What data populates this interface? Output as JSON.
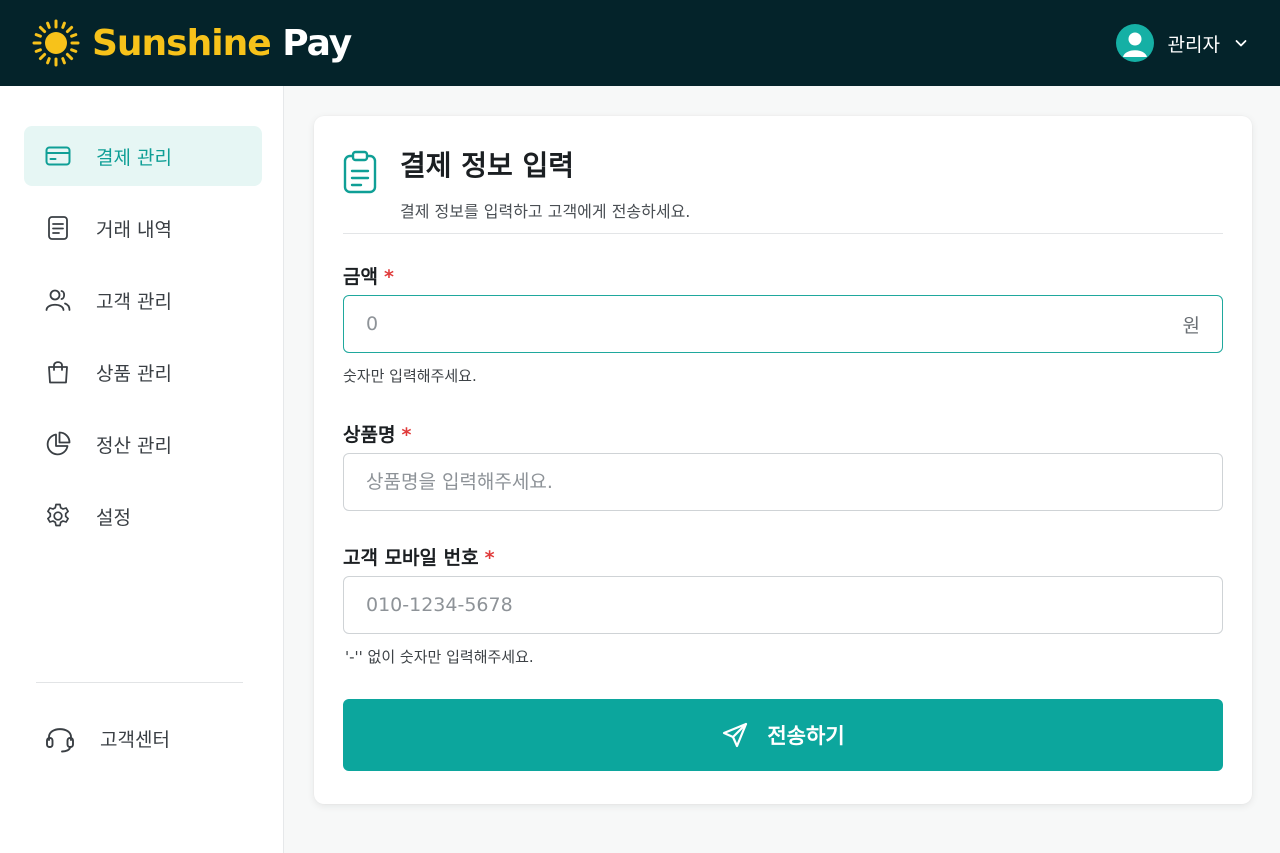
{
  "app": {
    "brand_part1": "Sunshine",
    "brand_part2": "Pay",
    "user_name": "관리자"
  },
  "sidebar": {
    "items": [
      {
        "label": "결제 관리",
        "icon": "credit-card-icon",
        "active": true
      },
      {
        "label": "거래 내역",
        "icon": "document-icon",
        "active": false
      },
      {
        "label": "고객 관리",
        "icon": "users-icon",
        "active": false
      },
      {
        "label": "상품 관리",
        "icon": "shopping-bag-icon",
        "active": false
      },
      {
        "label": "정산 관리",
        "icon": "pie-chart-icon",
        "active": false
      },
      {
        "label": "설정",
        "icon": "gear-icon",
        "active": false
      }
    ],
    "support_label": "고객센터"
  },
  "form": {
    "title": "결제 정보 입력",
    "subtitle": "결제 정보를 입력하고 고객에게 전송하세요.",
    "amount": {
      "label": "금액",
      "required_mark": "*",
      "placeholder": "0",
      "value": "",
      "unit": "원",
      "hint": "숫자만 입력해주세요."
    },
    "product": {
      "label": "상품명",
      "required_mark": "*",
      "placeholder": "상품명을 입력해주세요.",
      "value": ""
    },
    "phone": {
      "label": "고객 모바일 번호",
      "required_mark": "*",
      "placeholder": "010-1234-5678",
      "value": "",
      "hint": "'-'' 없이 숫자만 입력해주세요."
    },
    "submit_label": "전송하기"
  },
  "colors": {
    "header_bg": "#04232a",
    "brand_yellow": "#f7c21a",
    "accent": "#0ca69d",
    "required": "#e03b3b"
  }
}
